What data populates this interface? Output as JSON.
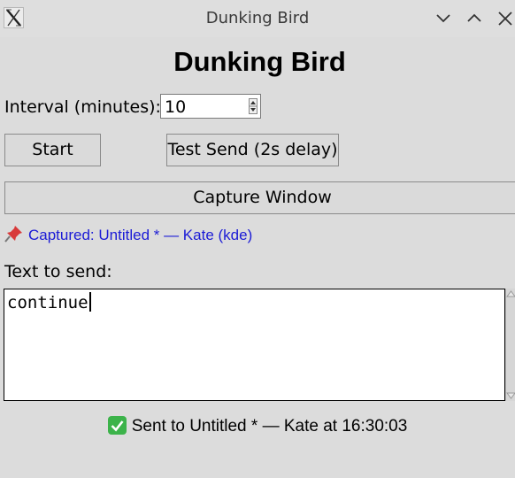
{
  "window": {
    "title": "Dunking Bird",
    "icons": {
      "app": "x-app-icon",
      "minimize": "chevron-down-icon",
      "maximize": "chevron-up-icon",
      "close": "close-icon"
    }
  },
  "app": {
    "heading": "Dunking Bird",
    "interval": {
      "label": "Interval (minutes):",
      "value": "10"
    },
    "buttons": {
      "start": "Start",
      "test_send": "Test Send (2s delay)",
      "capture_window": "Capture Window"
    },
    "captured": {
      "icon": "pushpin-icon",
      "text": "Captured: Untitled * — Kate (kde)",
      "color": "#1b1bd6"
    },
    "text_to_send": {
      "label": "Text to send:",
      "value": "continue"
    },
    "status": {
      "icon": "check-mark-icon",
      "text": "Sent to Untitled * — Kate at 16:30:03",
      "icon_color": "#3cb34a"
    }
  }
}
